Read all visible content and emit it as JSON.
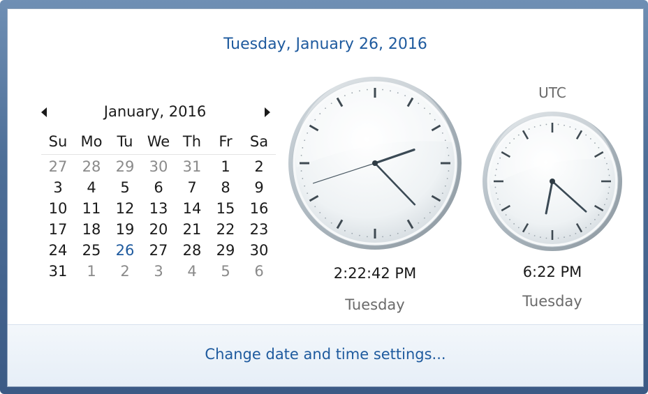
{
  "header": {
    "date_long": "Tuesday, January 26, 2016"
  },
  "calendar": {
    "month_title": "January, 2016",
    "prev_icon": "triangle-left-icon",
    "next_icon": "triangle-right-icon",
    "days_of_week": [
      "Su",
      "Mo",
      "Tu",
      "We",
      "Th",
      "Fr",
      "Sa"
    ],
    "weeks": [
      [
        "27",
        "28",
        "29",
        "30",
        "31",
        "1",
        "2"
      ],
      [
        "3",
        "4",
        "5",
        "6",
        "7",
        "8",
        "9"
      ],
      [
        "10",
        "11",
        "12",
        "13",
        "14",
        "15",
        "16"
      ],
      [
        "17",
        "18",
        "19",
        "20",
        "21",
        "22",
        "23"
      ],
      [
        "24",
        "25",
        "26",
        "27",
        "28",
        "29",
        "30"
      ],
      [
        "31",
        "1",
        "2",
        "3",
        "4",
        "5",
        "6"
      ]
    ],
    "other_month_cells": [
      [
        0,
        0
      ],
      [
        0,
        1
      ],
      [
        0,
        2
      ],
      [
        0,
        3
      ],
      [
        0,
        4
      ],
      [
        5,
        1
      ],
      [
        5,
        2
      ],
      [
        5,
        3
      ],
      [
        5,
        4
      ],
      [
        5,
        5
      ],
      [
        5,
        6
      ]
    ],
    "selected_cell": [
      4,
      2
    ]
  },
  "local_clock": {
    "time_text": "2:22:42 PM",
    "day_text": "Tuesday",
    "hours": 2,
    "minutes": 22,
    "seconds": 42
  },
  "utc_clock": {
    "label": "UTC",
    "time_text": "6:22 PM",
    "day_text": "Tuesday",
    "hours": 6,
    "minutes": 22
  },
  "footer": {
    "link_text": "Change date and time settings..."
  },
  "colors": {
    "accent_link": "#1e5a9e",
    "frame": "#4e6f98"
  }
}
